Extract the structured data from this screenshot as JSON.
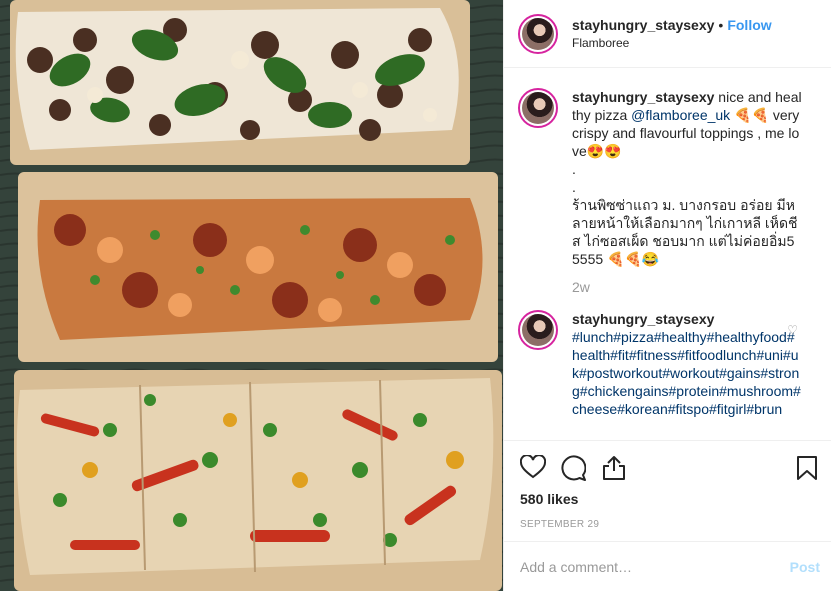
{
  "header": {
    "username": "stayhungry_staysexy",
    "separator": "•",
    "follow_label": "Follow",
    "location": "Flamboree"
  },
  "caption": {
    "username": "stayhungry_staysexy",
    "text_1": " nice and healthy pizza ",
    "mention": "@flamboree_uk",
    "text_2": " 🍕🍕 very crispy and flavourful toppings , me love😍😍",
    "dot_1": ".",
    "dot_2": ".",
    "thai": "ร้านพิซซ่าแถว ม. บางกรอบ อร่อย มีหลายหน้าให้เลือกมากๆ ไก่เกาหลี เห็ดชีส ไก่ซอสเผ็ด ชอบมาก แต่ไม่ค่อยอิ่ม55555 🍕🍕😂",
    "time": "2w"
  },
  "comment": {
    "username": "stayhungry_staysexy",
    "hashtags": "#lunch#pizza#healthy#healthyfood#health#fit#fitness#fitfoodlunch#uni#uk#postworkout#workout#gains#strong#chickengains#protein#mushroom#cheese#korean#fitspo#fitgirl#brun"
  },
  "actions": {
    "icons": [
      "heart-icon",
      "comment-icon",
      "share-icon",
      "bookmark-icon"
    ],
    "likes": "580 likes",
    "date": "SEPTEMBER 29"
  },
  "add_comment": {
    "placeholder": "Add a comment…",
    "post_label": "Post"
  },
  "colors": {
    "link": "#3897f0",
    "mention": "#003569",
    "muted": "#999999",
    "post_disabled": "#b2dffc",
    "border": "#efefef"
  }
}
